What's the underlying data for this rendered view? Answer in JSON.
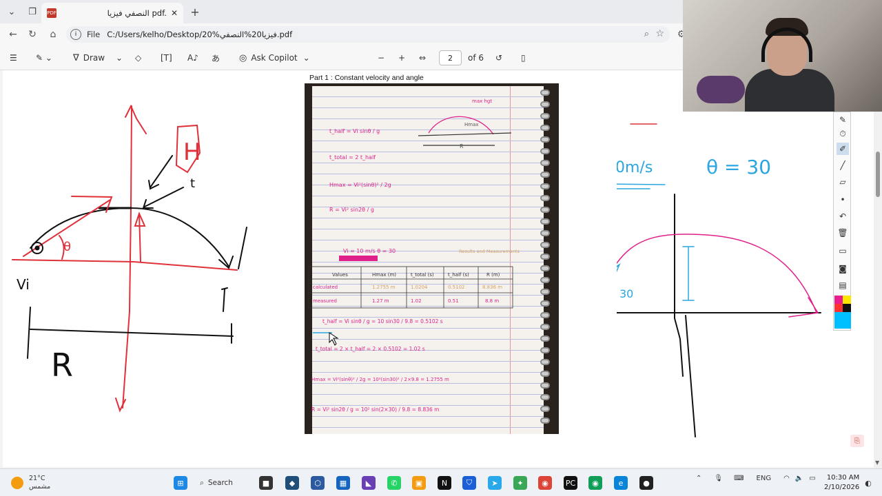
{
  "browser": {
    "tab_title": "النصفي فيزيا pdf.",
    "address_label": "File",
    "address_path": "C:/Users/kelho/Desktop/20%فيزيا20%النصفي.pdf"
  },
  "pdf_toolbar": {
    "draw_label": "Draw",
    "copilot_label": "Ask Copilot",
    "page_current": "2",
    "page_total": "of 6"
  },
  "document": {
    "part_title": "Part 1 : Constant velocity and angle"
  },
  "left_sketch": {
    "labels": [
      "H",
      "t",
      "θ",
      "Vi",
      "T",
      "R"
    ]
  },
  "right_sketch": {
    "speed": "10m/s",
    "angle_eq": "θ = 30",
    "angle_label": "30"
  },
  "notebook": {
    "eq1": "t_half = Vi sinθ / g",
    "eq2": "t_total = 2 t_half",
    "eq3": "Hmax = Vi²(sinθ)² / 2g",
    "eq4": "R = Vi² sin2θ / g",
    "given": "Vi = 10 m/s    θ = 30",
    "results_title": "Results and Measurements",
    "table_headers": [
      "Values",
      "Hmax (m)",
      "t_total (s)",
      "t_half (s)",
      "R (m)"
    ],
    "table_rows": [
      [
        "calculated",
        "1.2755 m",
        "1.0204",
        "0.5102",
        "8.836 m"
      ],
      [
        "measured",
        "1.27 m",
        "1.02",
        "0.51",
        "8.8 m"
      ]
    ],
    "calc1": "t_half = Vi sinθ / g = 10 sin30 / 9.8 = 0.5102 s",
    "calc2": "t_total = 2 × t_half = 2 × 0.5102 = 1.02 s",
    "calc3": "Hmax = Vi²(sinθ)² / 2g = 10²(sin30)² / 2×9.8 = 1.2755 m",
    "calc4": "R = Vi² sin2θ / g = 10² sin(2×30) / 9.8 = 8.836 m"
  },
  "taskbar": {
    "temp": "21°C",
    "weather": "مشمس",
    "search": "Search",
    "lang": "ENG",
    "time": "10:30 AM",
    "date": "2/10/2026"
  },
  "colors": {
    "red_ink": "#e0303a",
    "blue_ink": "#2aa6e0",
    "pink_ink": "#e0208a"
  }
}
